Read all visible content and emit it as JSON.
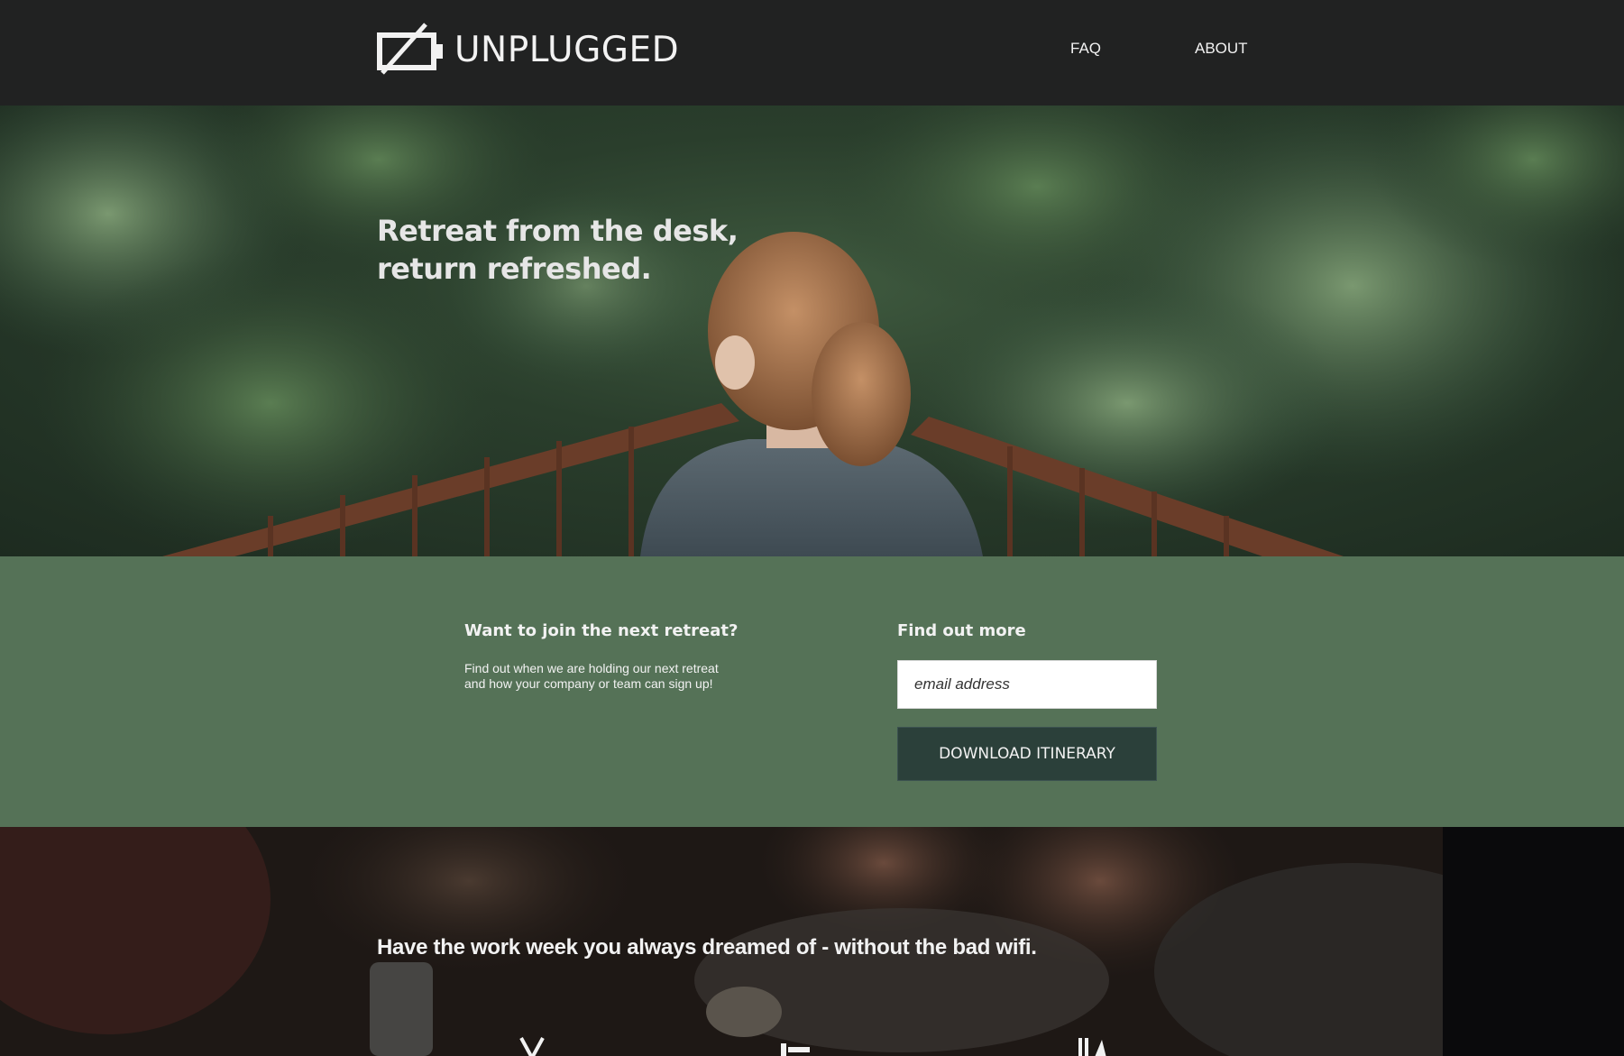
{
  "header": {
    "brand": "UNPLUGGED",
    "logo_icon": "battery-crossed-icon",
    "nav": [
      {
        "label": "FAQ"
      },
      {
        "label": "ABOUT"
      }
    ]
  },
  "hero": {
    "title": "Retreat from the desk, return refreshed."
  },
  "signup": {
    "join_heading": "Want to join the next retreat?",
    "join_text": "Find out when we are holding our next retreat and how your company or team can sign up!",
    "find_heading": "Find out more",
    "email_placeholder": "email address",
    "download_label": "DOWNLOAD ITINERARY"
  },
  "bottom": {
    "tagline": "Have the work week you always dreamed of - without the bad wifi."
  },
  "colors": {
    "header_bg": "#212222",
    "band_green": "#557257",
    "button_dark": "#2b403a",
    "text_light": "#f2f2f2"
  }
}
